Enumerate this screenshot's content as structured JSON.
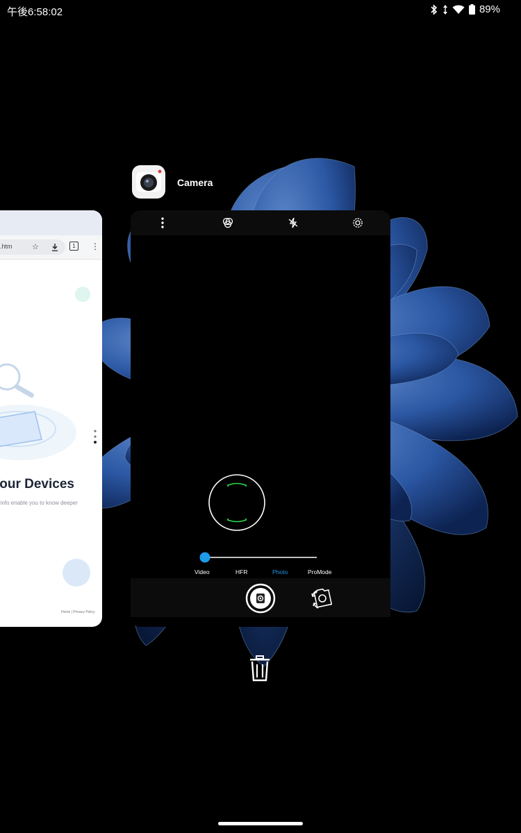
{
  "status_bar": {
    "time": "午後6:58:02",
    "battery": "89%",
    "icons": [
      "bluetooth-icon",
      "data-arrows-icon",
      "wifi-icon",
      "battery-icon"
    ]
  },
  "recents": {
    "browser_card": {
      "url_fragment": ".htm",
      "tab_count": "1",
      "headline": "Your Devices",
      "subtext": "e info enable you to know deeper",
      "footer": "Home | Privacy Policy"
    },
    "camera_card": {
      "app_name": "Camera",
      "top_icons": [
        "more-vert-icon",
        "filter-icon",
        "flash-off-icon",
        "settings-icon"
      ],
      "modes": [
        "Video",
        "HFR",
        "Photo",
        "ProMode"
      ],
      "active_mode": "Photo",
      "zoom_level": 0
    },
    "clear_all": "trash-icon"
  },
  "colors": {
    "accent": "#1e9be8",
    "focus_bracket": "#2dd94a",
    "background": "#000000",
    "petal_blue": "#2f5fae"
  }
}
